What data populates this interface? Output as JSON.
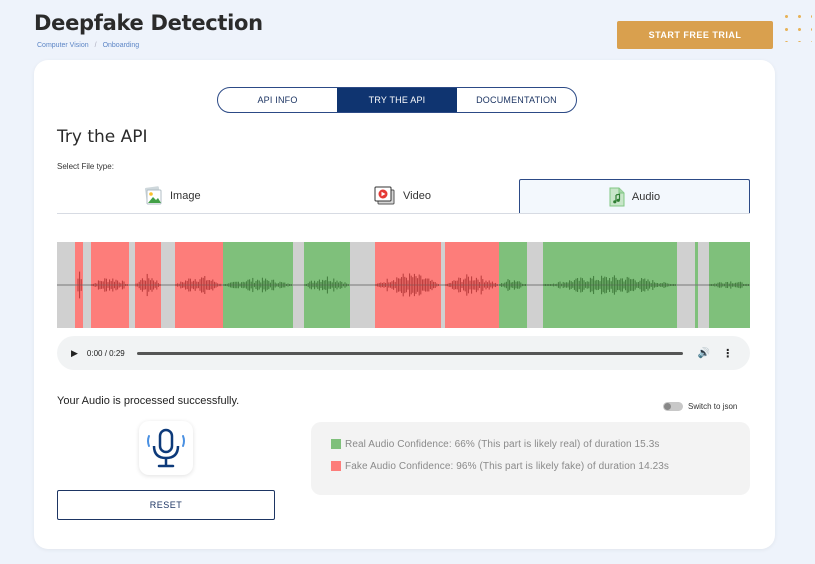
{
  "header": {
    "title": "Deepfake Detection",
    "breadcrumb": [
      "Computer Vision",
      "Onboarding"
    ],
    "trial_button": "START FREE TRIAL"
  },
  "tabs": [
    {
      "label": "API INFO",
      "active": false
    },
    {
      "label": "TRY THE API",
      "active": true
    },
    {
      "label": "DOCUMENTATION",
      "active": false
    }
  ],
  "main": {
    "section_title": "Try the API",
    "file_type_label": "Select File type:",
    "file_types": [
      {
        "label": "Image",
        "icon": "image-icon",
        "active": false
      },
      {
        "label": "Video",
        "icon": "video-icon",
        "active": false
      },
      {
        "label": "Audio",
        "icon": "audio-file-icon",
        "active": true
      }
    ]
  },
  "player": {
    "time": "0:00 / 0:29"
  },
  "status": {
    "message": "Your Audio is processed successfully.",
    "toggle_label": "Switch to json"
  },
  "reset_label": "RESET",
  "results": [
    {
      "text": "Real Audio Confidence: 66% (This part is likely real) of duration 15.3s",
      "color": "#7fc07b"
    },
    {
      "text": "Fake Audio Confidence: 96% (This part is likely fake) of duration 14.23s",
      "color": "#fd7d7a"
    }
  ],
  "colors": {
    "real": "#7fc07b",
    "fake": "#fd7d7a",
    "silence": "#d0d0d0",
    "accent": "#0f3470",
    "trial": "#d9a04e"
  }
}
